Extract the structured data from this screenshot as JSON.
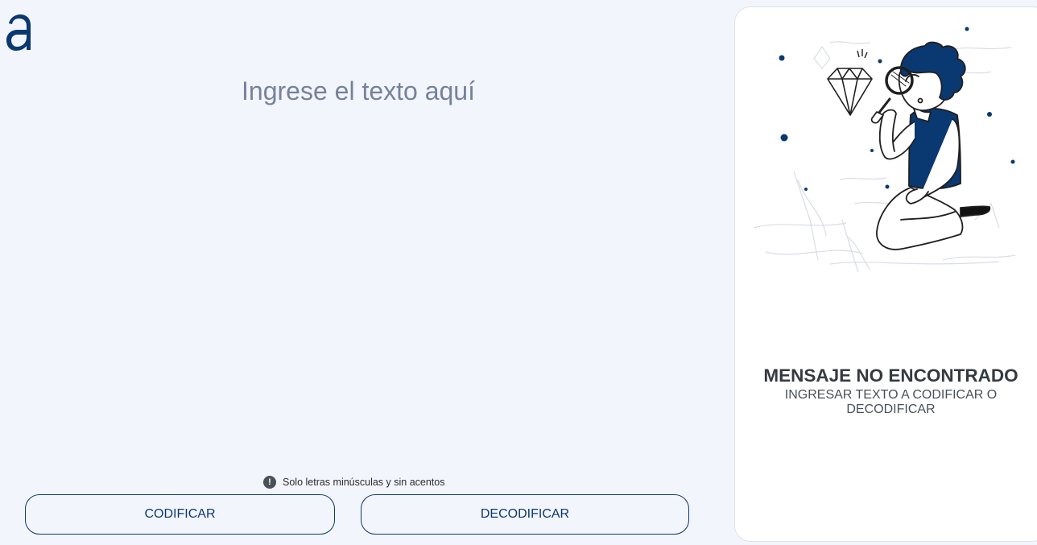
{
  "app": {
    "logo_icon": "alura-logo-icon",
    "colors": {
      "background": "#f3f5fc",
      "primary": "#0a3871",
      "placeholder": "#76829b",
      "panel": "#ffffff"
    }
  },
  "input": {
    "placeholder": "Ingrese el texto aquí",
    "value": ""
  },
  "hint": {
    "icon": "exclamation-circle-icon",
    "text": "Solo letras minúsculas y sin acentos"
  },
  "buttons": {
    "encode_label": "CODIFICAR",
    "decode_label": "DECODIFICAR"
  },
  "output": {
    "illustration_icon": "person-with-magnifying-glass-icon",
    "title": "MENSAJE NO ENCONTRADO",
    "subtitle": "INGRESAR TEXTO A CODIFICAR O DECODIFICAR"
  }
}
